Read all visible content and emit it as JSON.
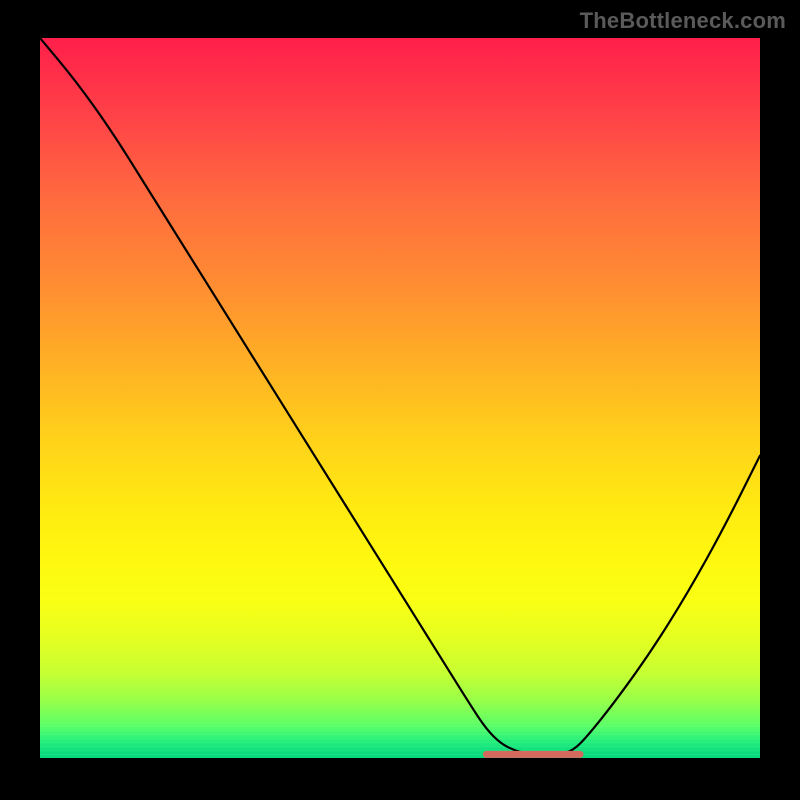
{
  "watermark": "TheBottleneck.com",
  "chart_data": {
    "type": "line",
    "title": "",
    "xlabel": "",
    "ylabel": "",
    "xlim": [
      0,
      100
    ],
    "ylim": [
      0,
      100
    ],
    "x": [
      0,
      5,
      10,
      15,
      20,
      25,
      30,
      35,
      40,
      45,
      50,
      55,
      60,
      62,
      64,
      66,
      68,
      70,
      72,
      74,
      76,
      80,
      85,
      90,
      95,
      100
    ],
    "values": [
      100,
      94,
      87,
      79,
      71,
      63,
      55,
      47,
      39,
      31,
      23,
      15,
      7,
      4,
      2,
      1,
      0.5,
      0.5,
      0.5,
      1,
      3,
      8,
      15,
      23,
      32,
      42
    ],
    "flat_segment": {
      "x_start": 62,
      "x_end": 75,
      "color": "#d46a5e",
      "value": 0.5
    },
    "gradient_stops": [
      {
        "pos": 0.0,
        "color": "#ff1f4a"
      },
      {
        "pos": 0.5,
        "color": "#ffd21a"
      },
      {
        "pos": 0.85,
        "color": "#eaff1c"
      },
      {
        "pos": 1.0,
        "color": "#07d97d"
      }
    ]
  }
}
